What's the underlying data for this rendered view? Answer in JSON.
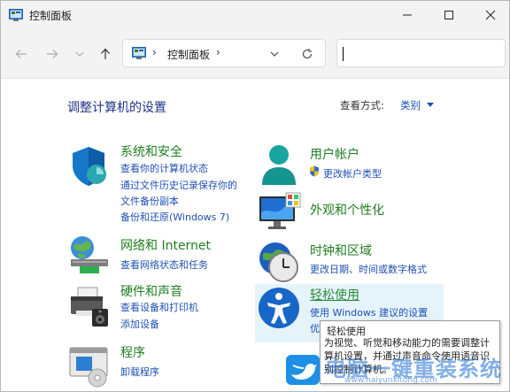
{
  "window": {
    "title": "控制面板"
  },
  "address": {
    "breadcrumb": "控制面板"
  },
  "search": {
    "value": ""
  },
  "main": {
    "heading": "调整计算机的设置",
    "view_by_label": "查看方式:",
    "view_by_value": "类别"
  },
  "categories": [
    {
      "title": "系统和安全",
      "icon": "shield-icon",
      "links": [
        "查看你的计算机状态",
        "通过文件历史记录保存你的",
        "文件备份副本",
        "备份和还原(Windows 7)"
      ]
    },
    {
      "title": "网络和 Internet",
      "icon": "network-icon",
      "links": [
        "查看网络状态和任务"
      ]
    },
    {
      "title": "硬件和声音",
      "icon": "printer-icon",
      "links": [
        "查看设备和打印机",
        "添加设备"
      ]
    },
    {
      "title": "程序",
      "icon": "programs-icon",
      "links": [
        "卸载程序"
      ]
    },
    {
      "title": "用户帐户",
      "icon": "user-icon",
      "links": [
        "更改帐户类型"
      ]
    },
    {
      "title": "外观和个性化",
      "icon": "monitor-icon",
      "links": []
    },
    {
      "title": "时钟和区域",
      "icon": "clock-icon",
      "links": [
        "更改日期、时间或数字格式"
      ]
    },
    {
      "title": "轻松使用",
      "icon": "accessibility-icon",
      "links": [
        "使用 Windows 建议的设置",
        "优"
      ]
    }
  ],
  "tooltip": {
    "title": "轻松使用",
    "body": "为视觉、听觉和移动能力的需要调整计算机设置，并通过声音命令使用语音识别控制计算机。"
  },
  "watermark": {
    "text": "电脑一键重装系统",
    "url": "www.haiyunxitong.com"
  }
}
